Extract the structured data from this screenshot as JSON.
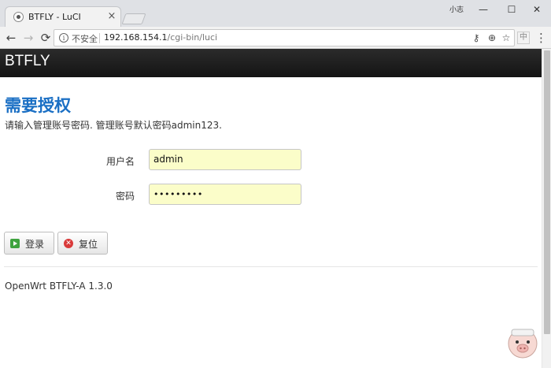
{
  "browser": {
    "tab_title": "BTFLY - LuCI",
    "tab_close": "×",
    "user_label": "小志",
    "window_controls": {
      "minimize": "—",
      "maximize": "☐",
      "close": "✕"
    },
    "nav": {
      "back": "←",
      "forward": "→",
      "reload": "⟳"
    },
    "security_label": "不安全",
    "url_host": "192.168.154.1",
    "url_path": "/cgi-bin/luci",
    "omnibox_icons": {
      "key": "⚷",
      "zoom": "⊕",
      "star": "☆"
    },
    "extension_label": "中",
    "menu": "⋮"
  },
  "page": {
    "brand": "BTFLY",
    "auth_title": "需要授权",
    "auth_description": "请输入管理账号密码. 管理账号默认密码admin123.",
    "form": {
      "username_label": "用户名",
      "username_value": "admin",
      "password_label": "密码",
      "password_value": "•••••••••"
    },
    "buttons": {
      "login": "登录",
      "reset": "复位",
      "reset_icon": "✕"
    },
    "footer": "OpenWrt BTFLY-A 1.3.0"
  },
  "colors": {
    "header_bg": "#1c1c1c",
    "title_blue": "#1a6fc4",
    "input_bg": "#fbfdc9"
  }
}
